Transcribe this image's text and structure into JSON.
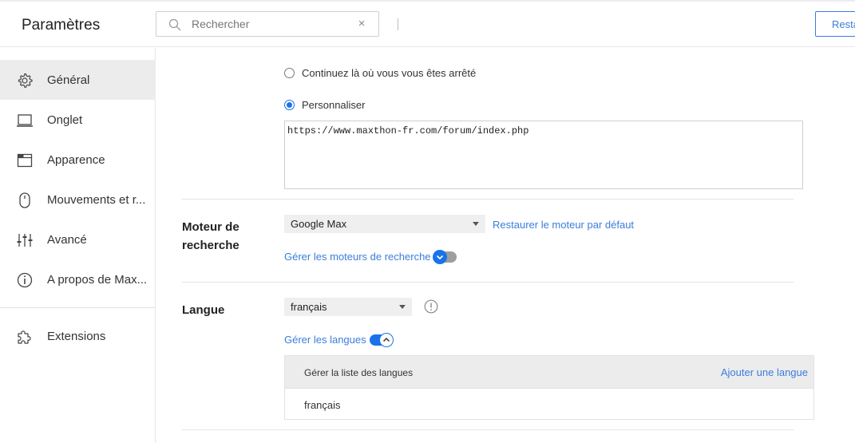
{
  "header": {
    "title": "Paramètres",
    "search": {
      "placeholder": "Rechercher",
      "clear_glyph": "×"
    },
    "restore_button_label": "Resta"
  },
  "sidebar": {
    "items": [
      {
        "label": "Général",
        "icon": "gear-icon",
        "active": true
      },
      {
        "label": "Onglet",
        "icon": "laptop-icon"
      },
      {
        "label": "Apparence",
        "icon": "window-icon"
      },
      {
        "label": "Mouvements et r...",
        "icon": "mouse-icon"
      },
      {
        "label": "Avancé",
        "icon": "sliders-icon"
      },
      {
        "label": "A propos de Max...",
        "icon": "info-icon"
      },
      {
        "label": "Extensions",
        "icon": "puzzle-icon"
      }
    ]
  },
  "startup": {
    "option_continue": "Continuez là où vous vous êtes arrêté",
    "option_custom": "Personnaliser",
    "selected": "custom",
    "custom_url": "https://www.maxthon-fr.com/forum/index.php"
  },
  "search_engine": {
    "title_line1": "Moteur de",
    "title_line2": "recherche",
    "selected": "Google Max",
    "restore_link": "Restaurer le moteur par défaut",
    "manage_link": "Gérer les moteurs de recherche"
  },
  "language": {
    "title": "Langue",
    "selected": "français",
    "manage_link": "Gérer les langues",
    "table_header": "Gérer la liste des langues",
    "add_link": "Ajouter une langue",
    "languages": [
      "français"
    ]
  },
  "colors": {
    "accent": "#1a73e8",
    "link": "#3b7ddd",
    "active_bg": "#ececec"
  }
}
